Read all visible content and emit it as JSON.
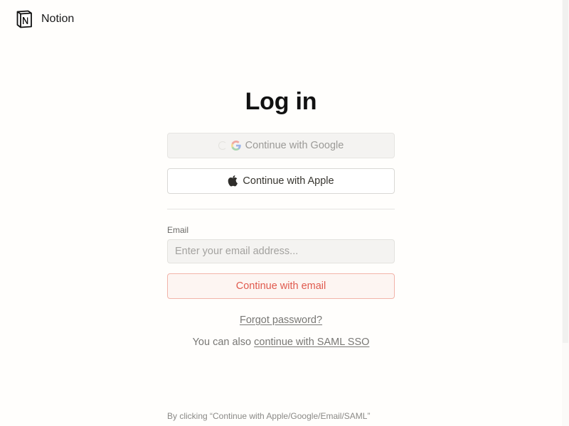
{
  "brand": {
    "name": "Notion",
    "logo_icon": "notion-logo-icon"
  },
  "login": {
    "title": "Log in",
    "google_label": "Continue with Google",
    "apple_label": "Continue with Apple",
    "email_label": "Email",
    "email_placeholder": "Enter your email address...",
    "email_value": "",
    "email_button_label": "Continue with email",
    "forgot_password": "Forgot password?",
    "saml_prefix": "You can also",
    "saml_link": "continue with SAML SSO",
    "terms_text": "By clicking “Continue with Apple/Google/Email/SAML”"
  },
  "icons": {
    "google": "google-icon",
    "apple": "apple-icon",
    "loading": "loading-spinner-icon"
  },
  "colors": {
    "background": "#fffefc",
    "accent_red": "#e05a4e",
    "email_button_bg": "#fdf5f2",
    "text": "#37352f"
  }
}
